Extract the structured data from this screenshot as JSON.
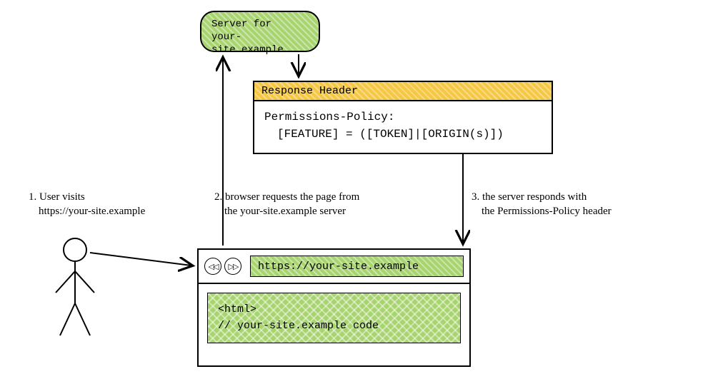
{
  "server": {
    "line1": "Server for",
    "line2": "your-site.example"
  },
  "response": {
    "header_title": "Response Header",
    "policy_name": "Permissions-Policy:",
    "policy_value": "[FEATURE] = ([TOKEN]|[ORIGIN(s)])"
  },
  "browser": {
    "back_glyph": "◁◁",
    "fwd_glyph": "▷▷",
    "url": "https://your-site.example",
    "code_line1": "<html>",
    "code_line2": "// your-site.example code"
  },
  "steps": {
    "s1_line1": "1. User visits",
    "s1_line2": "https://your-site.example",
    "s2_line1": "2. browser requests the page from",
    "s2_line2": "the your-site.example server",
    "s3_line1": "3. the server responds with",
    "s3_line2": "the Permissions-Policy header"
  }
}
